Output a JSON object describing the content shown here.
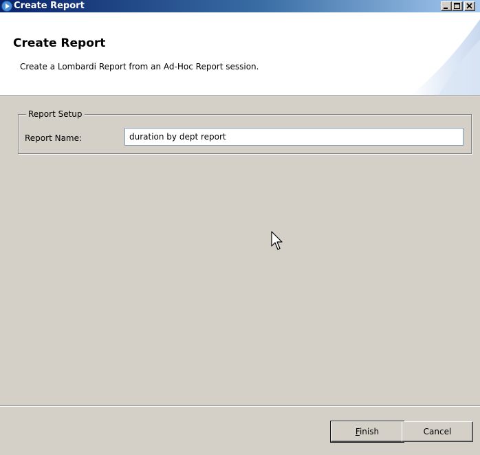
{
  "window": {
    "title": "Create Report",
    "controls": [
      "minimize-icon",
      "maximize-icon",
      "close-icon"
    ]
  },
  "banner": {
    "title": "Create Report",
    "description": "Create a Lombardi Report from an Ad-Hoc Report session."
  },
  "report_setup": {
    "group_label": "Report Setup",
    "name_label": "Report Name:",
    "name_value": "duration by dept report"
  },
  "buttons": {
    "finish_mnemonic": "F",
    "finish_rest": "inish",
    "cancel": "Cancel"
  },
  "colors": {
    "titlebar_start": "#0a246a",
    "titlebar_end": "#a6caf0",
    "dialog_bg": "#d4d0c8"
  }
}
